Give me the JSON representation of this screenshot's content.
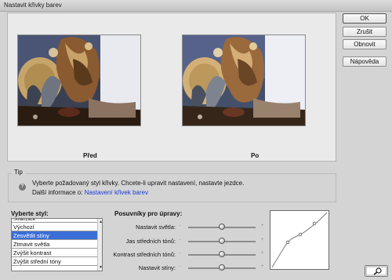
{
  "window": {
    "title": "Nastavit křivky barev"
  },
  "preview": {
    "before_label": "Před",
    "after_label": "Po"
  },
  "buttons": {
    "ok": "OK",
    "cancel": "Zrušit",
    "reset": "Obnovit",
    "help": "Nápověda"
  },
  "tip": {
    "title": "Tip",
    "text": "Vyberte požadovaný styl křivky. Chcete-li upravit nastavení, nastavte jezdce.",
    "info_prefix": "Další informace o: ",
    "info_link": "Nastavení křivek barev"
  },
  "styles": {
    "label": "Vyberte styl:",
    "items": [
      "Solarizace",
      "Výchozí",
      "Zesvětlit stíny",
      "Ztmavit světla",
      "Zvýšit kontrast",
      "Zvýšit střední tóny"
    ],
    "selected": "Zesvětlit stíny"
  },
  "sliders": {
    "label": "Posuvníky pro úpravy:",
    "items": [
      {
        "label": "Nastavit světla:",
        "value": 0.5
      },
      {
        "label": "Jas středních tónů:",
        "value": 0.5
      },
      {
        "label": "Kontrast středních tónů:",
        "value": 0.5
      },
      {
        "label": "Nastavit stíny:",
        "value": 0.5
      }
    ]
  },
  "icons": {
    "help": "question-icon",
    "zoom": "magnifier-icon"
  }
}
